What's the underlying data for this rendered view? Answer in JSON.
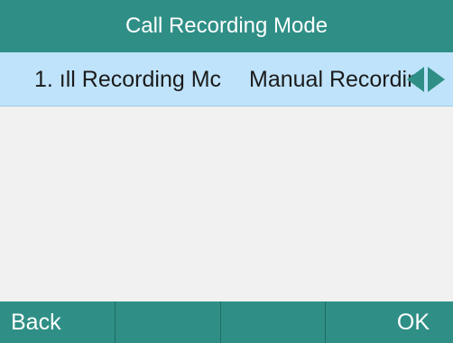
{
  "header": {
    "title": "Call Recording Mode"
  },
  "list": {
    "items": [
      {
        "label": "1. ıll Recording Mc",
        "value": "Manual Recording",
        "selected": true
      }
    ]
  },
  "softkeys": [
    {
      "label": "Back"
    },
    {
      "label": ""
    },
    {
      "label": ""
    },
    {
      "label": "OK"
    }
  ],
  "icons": {
    "left_arrow": "triangle-left-icon",
    "right_arrow": "triangle-right-icon"
  },
  "colors": {
    "bar": "#2f8f86",
    "selected_row": "#bfe3fb",
    "arrow": "#2f8f86"
  }
}
